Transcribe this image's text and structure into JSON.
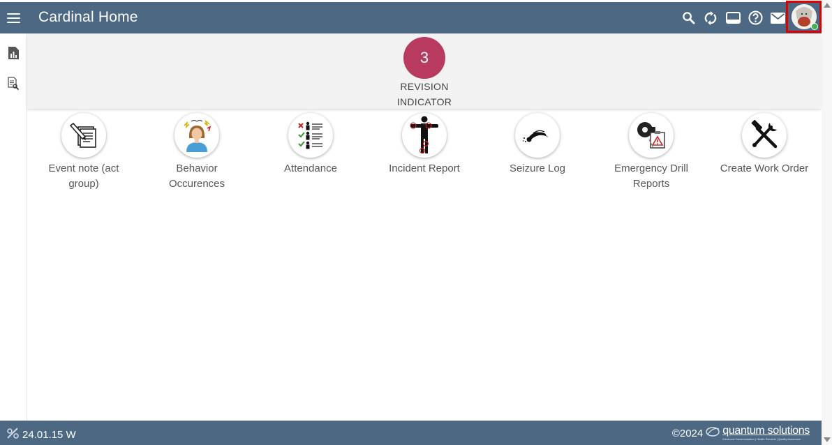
{
  "header": {
    "title": "Cardinal Home",
    "icons": [
      "search-icon",
      "sync-icon",
      "display-icon",
      "help-icon",
      "mail-icon"
    ]
  },
  "left_rail": {
    "icons": [
      "report-chart-icon",
      "document-search-icon"
    ]
  },
  "revision": {
    "count": "3",
    "label_line1": "REVISION",
    "label_line2": "INDICATOR",
    "color": "#b83a5e"
  },
  "tiles": [
    {
      "label": "Event note (act group)",
      "icon": "event-note-icon"
    },
    {
      "label": "Behavior Occurences",
      "icon": "behavior-icon"
    },
    {
      "label": "Attendance",
      "icon": "attendance-icon"
    },
    {
      "label": "Incident Report",
      "icon": "incident-icon"
    },
    {
      "label": "Seizure Log",
      "icon": "seizure-icon"
    },
    {
      "label": "Emergency Drill Reports",
      "icon": "emergency-drill-icon"
    },
    {
      "label": "Create Work Order",
      "icon": "tools-icon"
    }
  ],
  "footer": {
    "version": "24.01.15 W",
    "copyright": "©2024",
    "brand": "quantum solutions",
    "tagline": "Electronic Documentation | Health Records | Quality Assurance"
  },
  "colors": {
    "bar": "#4d6882",
    "highlight": "#e00000",
    "online": "#43b04a"
  }
}
